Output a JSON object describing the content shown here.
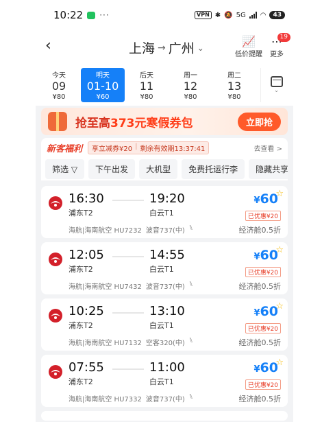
{
  "status": {
    "time": "10:22",
    "more_dots": "···",
    "vpn": "VPN",
    "network": "5G",
    "battery": "43"
  },
  "header": {
    "origin": "上海",
    "arrow": "→",
    "destination": "广州",
    "price_alert_label": "低价提醒",
    "more_label": "更多",
    "more_badge": "19"
  },
  "dates": [
    {
      "weekday": "今天",
      "date": "09",
      "price": "¥80"
    },
    {
      "weekday": "明天",
      "date": "01-10",
      "price": "¥60"
    },
    {
      "weekday": "后天",
      "date": "11",
      "price": "¥80"
    },
    {
      "weekday": "周一",
      "date": "12",
      "price": "¥80"
    },
    {
      "weekday": "周二",
      "date": "13",
      "price": "¥80"
    }
  ],
  "banner": {
    "prefix": "抢至高",
    "amount": "373元寒假券包",
    "button": "立即抢"
  },
  "promo": {
    "tag": "新客福利",
    "coupon": "享立减券¥20",
    "sep": "|",
    "timer": "剩余有效期13:37:41",
    "link": "去查看 >"
  },
  "filters": [
    "筛选 ▽",
    "下午出发",
    "大机型",
    "免费托运行李",
    "隐藏共享"
  ],
  "flights": [
    {
      "dep_time": "16:30",
      "dep_airport": "浦东T2",
      "arr_time": "19:20",
      "arr_airport": "白云T1",
      "airline": "海航|海南航空 HU7232",
      "aircraft": "波音737(中)",
      "price": "60",
      "discount": "已优惠¥20",
      "cabin": "经济舱0.5折"
    },
    {
      "dep_time": "12:05",
      "dep_airport": "浦东T2",
      "arr_time": "14:55",
      "arr_airport": "白云T1",
      "airline": "海航|海南航空 HU7432",
      "aircraft": "波音737(中)",
      "price": "60",
      "discount": "已优惠¥20",
      "cabin": "经济舱0.5折"
    },
    {
      "dep_time": "10:25",
      "dep_airport": "浦东T2",
      "arr_time": "13:10",
      "arr_airport": "白云T1",
      "airline": "海航|海南航空 HU7132",
      "aircraft": "空客320(中)",
      "price": "60",
      "discount": "已优惠¥20",
      "cabin": "经济舱0.5折"
    },
    {
      "dep_time": "07:55",
      "dep_airport": "浦东T2",
      "arr_time": "11:00",
      "arr_airport": "白云T1",
      "airline": "海航|海南航空 HU7332",
      "aircraft": "波音737(中)",
      "price": "60",
      "discount": "已优惠¥20",
      "cabin": "经济舱0.5折"
    }
  ],
  "currency": "¥",
  "colors": {
    "accent": "#1580f8",
    "promo": "#ff5a2a",
    "discount": "#e8402a"
  }
}
